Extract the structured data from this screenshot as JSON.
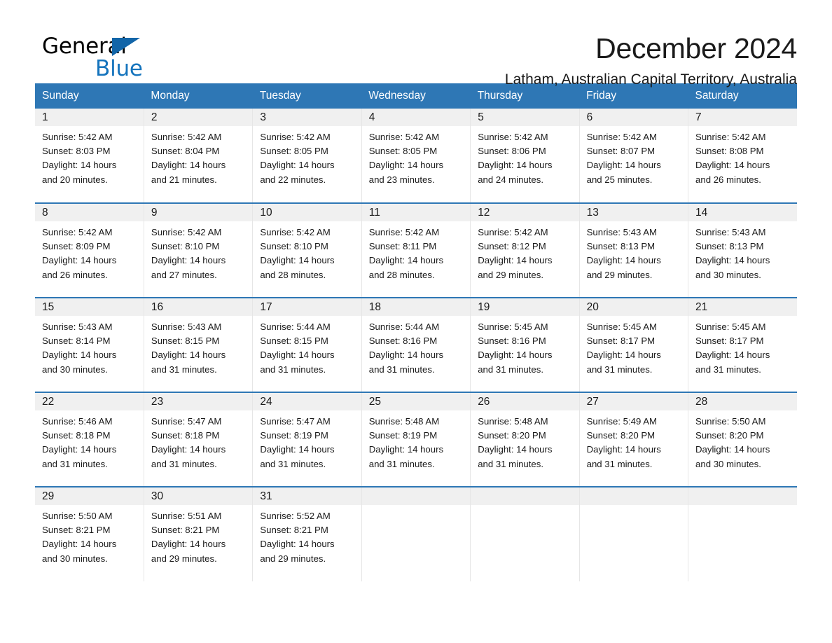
{
  "brand": {
    "word1": "General",
    "word2": "Blue",
    "triangle_icon": "brand-triangle-icon",
    "accent_color": "#1574bd",
    "triangle_color": "#1265a8"
  },
  "header": {
    "title": "December 2024",
    "subtitle": "Latham, Australian Capital Territory, Australia"
  },
  "theme": {
    "header_blue": "#2e77b5",
    "daynum_band": "#f0f0f0",
    "text": "#1a1a1a",
    "cell_divider": "#e6e6e6"
  },
  "calendar": {
    "columns": [
      "Sunday",
      "Monday",
      "Tuesday",
      "Wednesday",
      "Thursday",
      "Friday",
      "Saturday"
    ],
    "labels": {
      "sunrise": "Sunrise:",
      "sunset": "Sunset:",
      "daylight": "Daylight:"
    },
    "weeks": [
      [
        {
          "day": "1",
          "sunrise": "Sunrise: 5:42 AM",
          "sunset": "Sunset: 8:03 PM",
          "daylight_line1": "Daylight: 14 hours",
          "daylight_line2": "and 20 minutes."
        },
        {
          "day": "2",
          "sunrise": "Sunrise: 5:42 AM",
          "sunset": "Sunset: 8:04 PM",
          "daylight_line1": "Daylight: 14 hours",
          "daylight_line2": "and 21 minutes."
        },
        {
          "day": "3",
          "sunrise": "Sunrise: 5:42 AM",
          "sunset": "Sunset: 8:05 PM",
          "daylight_line1": "Daylight: 14 hours",
          "daylight_line2": "and 22 minutes."
        },
        {
          "day": "4",
          "sunrise": "Sunrise: 5:42 AM",
          "sunset": "Sunset: 8:05 PM",
          "daylight_line1": "Daylight: 14 hours",
          "daylight_line2": "and 23 minutes."
        },
        {
          "day": "5",
          "sunrise": "Sunrise: 5:42 AM",
          "sunset": "Sunset: 8:06 PM",
          "daylight_line1": "Daylight: 14 hours",
          "daylight_line2": "and 24 minutes."
        },
        {
          "day": "6",
          "sunrise": "Sunrise: 5:42 AM",
          "sunset": "Sunset: 8:07 PM",
          "daylight_line1": "Daylight: 14 hours",
          "daylight_line2": "and 25 minutes."
        },
        {
          "day": "7",
          "sunrise": "Sunrise: 5:42 AM",
          "sunset": "Sunset: 8:08 PM",
          "daylight_line1": "Daylight: 14 hours",
          "daylight_line2": "and 26 minutes."
        }
      ],
      [
        {
          "day": "8",
          "sunrise": "Sunrise: 5:42 AM",
          "sunset": "Sunset: 8:09 PM",
          "daylight_line1": "Daylight: 14 hours",
          "daylight_line2": "and 26 minutes."
        },
        {
          "day": "9",
          "sunrise": "Sunrise: 5:42 AM",
          "sunset": "Sunset: 8:10 PM",
          "daylight_line1": "Daylight: 14 hours",
          "daylight_line2": "and 27 minutes."
        },
        {
          "day": "10",
          "sunrise": "Sunrise: 5:42 AM",
          "sunset": "Sunset: 8:10 PM",
          "daylight_line1": "Daylight: 14 hours",
          "daylight_line2": "and 28 minutes."
        },
        {
          "day": "11",
          "sunrise": "Sunrise: 5:42 AM",
          "sunset": "Sunset: 8:11 PM",
          "daylight_line1": "Daylight: 14 hours",
          "daylight_line2": "and 28 minutes."
        },
        {
          "day": "12",
          "sunrise": "Sunrise: 5:42 AM",
          "sunset": "Sunset: 8:12 PM",
          "daylight_line1": "Daylight: 14 hours",
          "daylight_line2": "and 29 minutes."
        },
        {
          "day": "13",
          "sunrise": "Sunrise: 5:43 AM",
          "sunset": "Sunset: 8:13 PM",
          "daylight_line1": "Daylight: 14 hours",
          "daylight_line2": "and 29 minutes."
        },
        {
          "day": "14",
          "sunrise": "Sunrise: 5:43 AM",
          "sunset": "Sunset: 8:13 PM",
          "daylight_line1": "Daylight: 14 hours",
          "daylight_line2": "and 30 minutes."
        }
      ],
      [
        {
          "day": "15",
          "sunrise": "Sunrise: 5:43 AM",
          "sunset": "Sunset: 8:14 PM",
          "daylight_line1": "Daylight: 14 hours",
          "daylight_line2": "and 30 minutes."
        },
        {
          "day": "16",
          "sunrise": "Sunrise: 5:43 AM",
          "sunset": "Sunset: 8:15 PM",
          "daylight_line1": "Daylight: 14 hours",
          "daylight_line2": "and 31 minutes."
        },
        {
          "day": "17",
          "sunrise": "Sunrise: 5:44 AM",
          "sunset": "Sunset: 8:15 PM",
          "daylight_line1": "Daylight: 14 hours",
          "daylight_line2": "and 31 minutes."
        },
        {
          "day": "18",
          "sunrise": "Sunrise: 5:44 AM",
          "sunset": "Sunset: 8:16 PM",
          "daylight_line1": "Daylight: 14 hours",
          "daylight_line2": "and 31 minutes."
        },
        {
          "day": "19",
          "sunrise": "Sunrise: 5:45 AM",
          "sunset": "Sunset: 8:16 PM",
          "daylight_line1": "Daylight: 14 hours",
          "daylight_line2": "and 31 minutes."
        },
        {
          "day": "20",
          "sunrise": "Sunrise: 5:45 AM",
          "sunset": "Sunset: 8:17 PM",
          "daylight_line1": "Daylight: 14 hours",
          "daylight_line2": "and 31 minutes."
        },
        {
          "day": "21",
          "sunrise": "Sunrise: 5:45 AM",
          "sunset": "Sunset: 8:17 PM",
          "daylight_line1": "Daylight: 14 hours",
          "daylight_line2": "and 31 minutes."
        }
      ],
      [
        {
          "day": "22",
          "sunrise": "Sunrise: 5:46 AM",
          "sunset": "Sunset: 8:18 PM",
          "daylight_line1": "Daylight: 14 hours",
          "daylight_line2": "and 31 minutes."
        },
        {
          "day": "23",
          "sunrise": "Sunrise: 5:47 AM",
          "sunset": "Sunset: 8:18 PM",
          "daylight_line1": "Daylight: 14 hours",
          "daylight_line2": "and 31 minutes."
        },
        {
          "day": "24",
          "sunrise": "Sunrise: 5:47 AM",
          "sunset": "Sunset: 8:19 PM",
          "daylight_line1": "Daylight: 14 hours",
          "daylight_line2": "and 31 minutes."
        },
        {
          "day": "25",
          "sunrise": "Sunrise: 5:48 AM",
          "sunset": "Sunset: 8:19 PM",
          "daylight_line1": "Daylight: 14 hours",
          "daylight_line2": "and 31 minutes."
        },
        {
          "day": "26",
          "sunrise": "Sunrise: 5:48 AM",
          "sunset": "Sunset: 8:20 PM",
          "daylight_line1": "Daylight: 14 hours",
          "daylight_line2": "and 31 minutes."
        },
        {
          "day": "27",
          "sunrise": "Sunrise: 5:49 AM",
          "sunset": "Sunset: 8:20 PM",
          "daylight_line1": "Daylight: 14 hours",
          "daylight_line2": "and 31 minutes."
        },
        {
          "day": "28",
          "sunrise": "Sunrise: 5:50 AM",
          "sunset": "Sunset: 8:20 PM",
          "daylight_line1": "Daylight: 14 hours",
          "daylight_line2": "and 30 minutes."
        }
      ],
      [
        {
          "day": "29",
          "sunrise": "Sunrise: 5:50 AM",
          "sunset": "Sunset: 8:21 PM",
          "daylight_line1": "Daylight: 14 hours",
          "daylight_line2": "and 30 minutes."
        },
        {
          "day": "30",
          "sunrise": "Sunrise: 5:51 AM",
          "sunset": "Sunset: 8:21 PM",
          "daylight_line1": "Daylight: 14 hours",
          "daylight_line2": "and 29 minutes."
        },
        {
          "day": "31",
          "sunrise": "Sunrise: 5:52 AM",
          "sunset": "Sunset: 8:21 PM",
          "daylight_line1": "Daylight: 14 hours",
          "daylight_line2": "and 29 minutes."
        },
        {
          "day": "",
          "sunrise": "",
          "sunset": "",
          "daylight_line1": "",
          "daylight_line2": ""
        },
        {
          "day": "",
          "sunrise": "",
          "sunset": "",
          "daylight_line1": "",
          "daylight_line2": ""
        },
        {
          "day": "",
          "sunrise": "",
          "sunset": "",
          "daylight_line1": "",
          "daylight_line2": ""
        },
        {
          "day": "",
          "sunrise": "",
          "sunset": "",
          "daylight_line1": "",
          "daylight_line2": ""
        }
      ]
    ]
  }
}
